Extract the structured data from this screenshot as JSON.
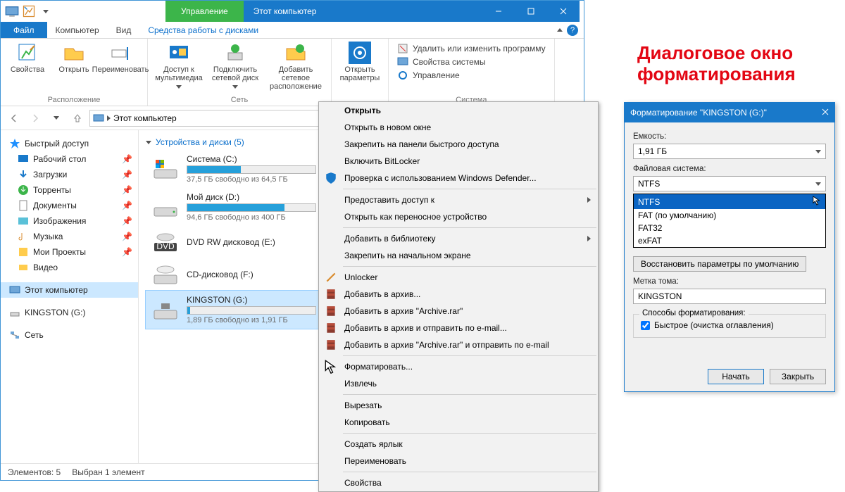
{
  "titlebar": {
    "tab_manage": "Управление",
    "tab_title": "Этот компьютер"
  },
  "ribbonTabs": {
    "file": "Файл",
    "computer": "Компьютер",
    "view": "Вид",
    "drive": "Средства работы с дисками"
  },
  "ribbon": {
    "g1": {
      "props": "Свойства",
      "open": "Открыть",
      "rename": "Переименовать",
      "label": "Расположение"
    },
    "g2": {
      "media": "Доступ к мультимедиа",
      "netdrive": "Подключить сетевой диск",
      "netloc": "Добавить сетевое расположение",
      "label": "Сеть"
    },
    "g3": {
      "openparams": "Открыть параметры"
    },
    "g4": {
      "uninstall": "Удалить или изменить программу",
      "sysprops": "Свойства системы",
      "manage": "Управление",
      "label": "Система"
    }
  },
  "addr": {
    "path": "Этот компьютер"
  },
  "sidebar": {
    "quick": "Быстрый доступ",
    "items": [
      {
        "label": "Рабочий стол",
        "pin": true
      },
      {
        "label": "Загрузки",
        "pin": true
      },
      {
        "label": "Торренты",
        "pin": true
      },
      {
        "label": "Документы",
        "pin": true
      },
      {
        "label": "Изображения",
        "pin": true
      },
      {
        "label": "Музыка",
        "pin": true
      },
      {
        "label": "Мои Проекты",
        "pin": true
      },
      {
        "label": "Видео",
        "pin": false
      }
    ],
    "thispc": "Этот компьютер",
    "kingston": "KINGSTON (G:)",
    "network": "Сеть"
  },
  "main": {
    "group": "Устройства и диски (5)",
    "drives": [
      {
        "name": "Система (C:)",
        "free": "37,5 ГБ свободно из 64,5 ГБ",
        "fill": 42
      },
      {
        "name": "Мой диск (D:)",
        "free": "94,6 ГБ свободно из 400 ГБ",
        "fill": 76
      },
      {
        "name": "DVD RW дисковод (E:)",
        "free": "",
        "fill": -1
      },
      {
        "name": "CD-дисковод (F:)",
        "free": "",
        "fill": -1
      },
      {
        "name": "KINGSTON (G:)",
        "free": "1,89 ГБ свободно из 1,91 ГБ",
        "fill": 2
      }
    ]
  },
  "status": {
    "count": "Элементов: 5",
    "sel": "Выбран 1 элемент"
  },
  "ctx": {
    "open": "Открыть",
    "newwin": "Открыть в новом окне",
    "pinqa": "Закрепить на панели быстрого доступа",
    "bitlocker": "Включить BitLocker",
    "defender": "Проверка с использованием Windows Defender...",
    "share": "Предоставить доступ к",
    "portable": "Открыть как переносное устройство",
    "library": "Добавить в библиотеку",
    "start": "Закрепить на начальном экране",
    "unlocker": "Unlocker",
    "arch1": "Добавить в архив...",
    "arch2": "Добавить в архив \"Archive.rar\"",
    "arch3": "Добавить в архив и отправить по e-mail...",
    "arch4": "Добавить в архив \"Archive.rar\" и отправить по e-mail",
    "format": "Форматировать...",
    "eject": "Извлечь",
    "cut": "Вырезать",
    "copy": "Копировать",
    "shortcut": "Создать ярлык",
    "rename": "Переименовать",
    "props": "Свойства"
  },
  "rightTitle": "Диалоговое окно форматирования",
  "fmt": {
    "title": "Форматирование \"KINGSTON (G:)\"",
    "capLabel": "Емкость:",
    "capVal": "1,91 ГБ",
    "fsLabel": "Файловая система:",
    "fsVal": "NTFS",
    "fsOpts": [
      "NTFS",
      "FAT (по умолчанию)",
      "FAT32",
      "exFAT"
    ],
    "restore": "Восстановить параметры по умолчанию",
    "volLabel": "Метка тома:",
    "volVal": "KINGSTON",
    "modeLabel": "Способы форматирования:",
    "quick": "Быстрое (очистка оглавления)",
    "start": "Начать",
    "close": "Закрыть"
  }
}
